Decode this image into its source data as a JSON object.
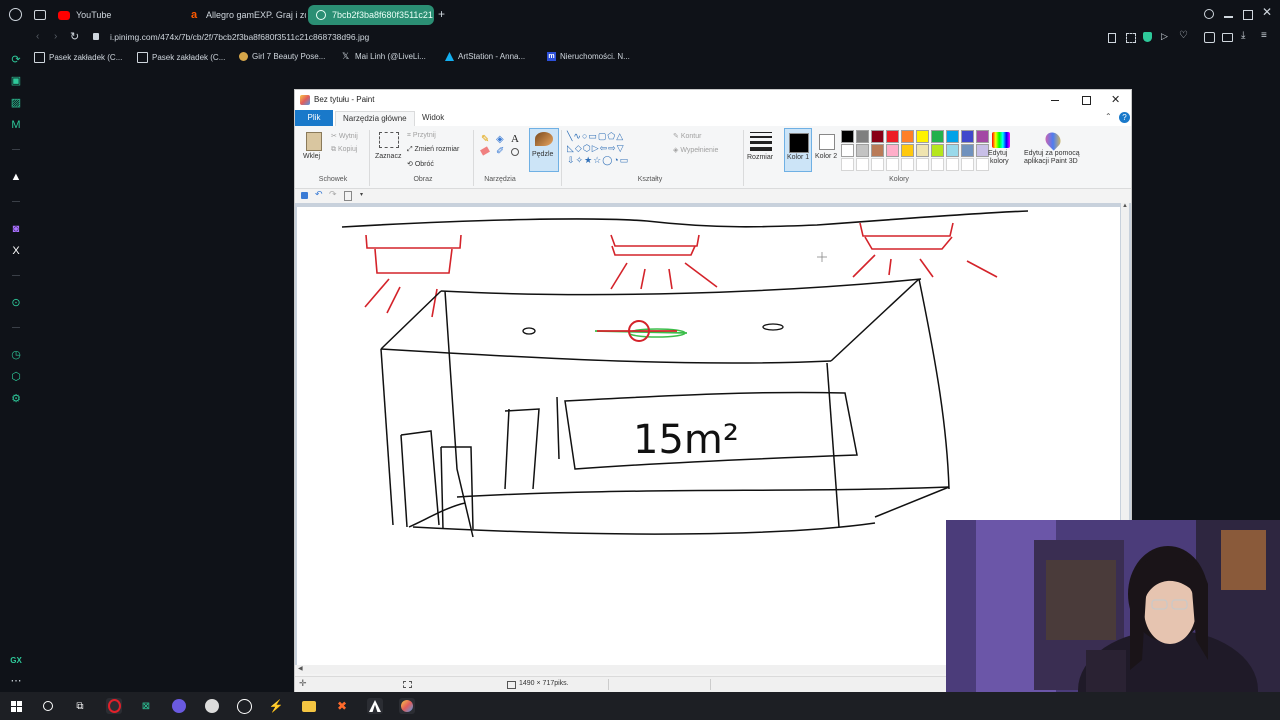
{
  "browser": {
    "tabs": [
      {
        "label": "YouTube",
        "icon": "youtube-icon",
        "active": false
      },
      {
        "label": "Allegro gamEXP. Graj i zd",
        "icon": "allegro-icon",
        "active": false
      },
      {
        "label": "7bcb2f3ba8f680f3511c21",
        "icon": "image-tab-icon",
        "active": true
      }
    ],
    "url": "i.pinimg.com/474x/7b/cb/2f/7bcb2f3ba8f680f3511c21c868738d96.jpg",
    "bookmarks": [
      {
        "label": "Pasek zakładek (C...",
        "icon": "folder-icon"
      },
      {
        "label": "Pasek zakładek (C...",
        "icon": "folder-icon"
      },
      {
        "label": "Girl 7 Beauty Pose...",
        "icon": "site-icon"
      },
      {
        "label": "Mai Linh (@LiveLi...",
        "icon": "x-icon"
      },
      {
        "label": "ArtStation - Anna...",
        "icon": "artstation-icon"
      },
      {
        "label": "Nieruchomości. N...",
        "icon": "m-icon"
      }
    ],
    "accent": "#2ec99a"
  },
  "paint": {
    "title": "Bez tytułu - Paint",
    "menu_tabs": [
      "Plik",
      "Narzędzia główne",
      "Widok"
    ],
    "groups": {
      "clipboard": {
        "label": "Schowek",
        "paste": "Wklej",
        "cut": "Wytnij",
        "copy": "Kopiuj"
      },
      "image": {
        "label": "Obraz",
        "select": "Zaznacz",
        "crop": "Przytnij",
        "resize": "Zmień rozmiar",
        "rotate": "Obróć"
      },
      "tools": {
        "label": "Narzędzia"
      },
      "brushes": {
        "label": "Pędzle"
      },
      "shapes": {
        "label": "Kształty",
        "outline": "Kontur",
        "fill": "Wypełnienie"
      },
      "size": {
        "label": "Rozmiar"
      },
      "color1": {
        "label": "Kolor 1"
      },
      "color2": {
        "label": "Kolor 2"
      },
      "colors": {
        "label": "Kolory"
      },
      "edit_colors": {
        "label1": "Edytuj",
        "label2": "kolory"
      },
      "paint3d": {
        "label1": "Edytuj za pomocą",
        "label2": "aplikacji Paint 3D"
      }
    },
    "palette": [
      "#000000",
      "#7f7f7f",
      "#880015",
      "#ed1c24",
      "#ff7f27",
      "#fff200",
      "#22b14c",
      "#00a2e8",
      "#3f48cc",
      "#a349a4",
      "#ffffff",
      "#c3c3c3",
      "#b97a57",
      "#ffaec9",
      "#ffc90e",
      "#efe4b0",
      "#b5e61d",
      "#99d9ea",
      "#7092be",
      "#c8bfe7"
    ],
    "color1": "#000000",
    "color2": "#ffffff",
    "drawing_text": "15m²",
    "status": {
      "dimensions": "1490 × 717piks."
    }
  }
}
